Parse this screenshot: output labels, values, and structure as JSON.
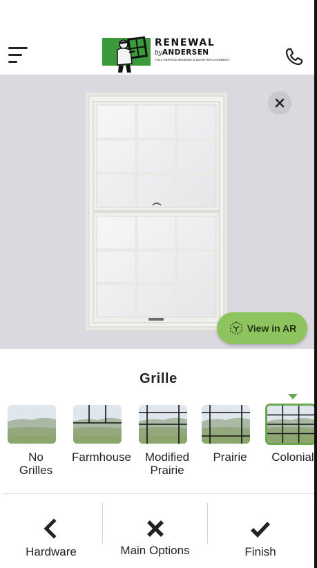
{
  "header": {
    "brand_line1": "RENEWAL",
    "brand_by": "by",
    "brand_line2": "ANDERSEN",
    "brand_tagline": "FULL-SERVICE WINDOW & DOOR REPLACEMENT",
    "menu_icon": "hamburger-menu-icon",
    "phone_icon": "phone-icon"
  },
  "preview": {
    "close_icon": "close-icon",
    "ar_button_label": "View in AR",
    "ar_icon": "ar-cube-icon"
  },
  "options": {
    "title": "Grille",
    "selected": "Colonial",
    "accent_color": "#6aa84f",
    "items": [
      {
        "label": "No\nGrilles"
      },
      {
        "label": "Farmhouse"
      },
      {
        "label": "Modified\nPrairie"
      },
      {
        "label": "Prairie"
      },
      {
        "label": "Colonial"
      }
    ]
  },
  "nav": {
    "items": [
      {
        "label": "Hardware",
        "icon": "chevron-left-icon"
      },
      {
        "label": "Main Options",
        "icon": "close-icon"
      },
      {
        "label": "Finish",
        "icon": "checkmark-icon"
      }
    ]
  },
  "colors": {
    "preview_bg": "#dcd8e0",
    "ar_button": "#8ec460",
    "brand_green": "#3c9a3c"
  }
}
